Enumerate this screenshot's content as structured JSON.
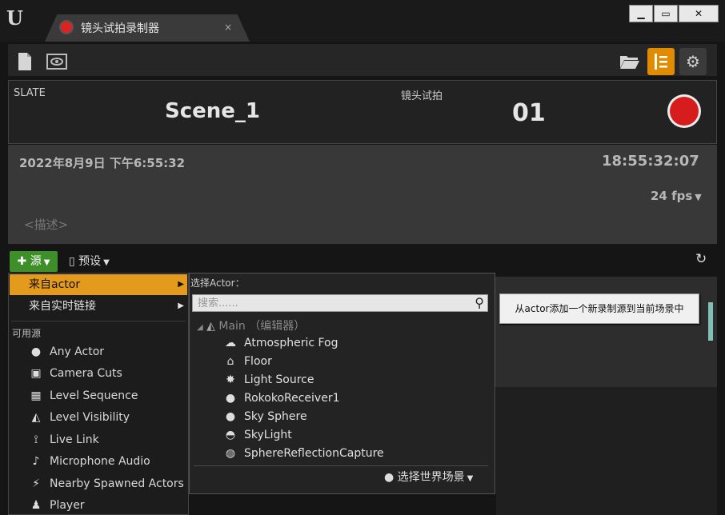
{
  "window": {
    "tab_title": "镜头试拍录制器",
    "tab_close": "×",
    "minimize_glyph": "▁",
    "maximize_glyph": "▭",
    "close_glyph": "✕"
  },
  "toolbar": {
    "new_icon": "document-icon",
    "review_icon": "film-eye-icon",
    "open_icon": "folder-icon",
    "timecode_icon": "timecode-icon",
    "settings_icon": "gears-icon",
    "accent_color": "#e08b00"
  },
  "slate": {
    "slate_label": "SLATE",
    "slate_value": "Scene_1",
    "take_label": "镜头试拍",
    "take_value": "01",
    "record_color": "#d61c1c"
  },
  "info": {
    "datetime": "2022年8月9日 下午6:55:32",
    "timecode": "18:55:32:07",
    "fps": "24 fps",
    "description_placeholder": "<描述>"
  },
  "sources_bar": {
    "add_source_label": "源",
    "presets_label": "预设",
    "add_color": "#3e8e2a"
  },
  "source_menu": {
    "from_actor": "来自actor",
    "from_livelink": "来自实时链接",
    "available_header": "可用源",
    "items": [
      {
        "label": "Any Actor",
        "icon": "sphere-icon"
      },
      {
        "label": "Camera Cuts",
        "icon": "camera-cuts-icon"
      },
      {
        "label": "Level Sequence",
        "icon": "clapper-icon"
      },
      {
        "label": "Level Visibility",
        "icon": "landscape-icon"
      },
      {
        "label": "Live Link",
        "icon": "live-link-icon"
      },
      {
        "label": "Microphone Audio",
        "icon": "microphone-icon"
      },
      {
        "label": "Nearby Spawned Actors",
        "icon": "spawn-icon"
      },
      {
        "label": "Player",
        "icon": "player-icon"
      }
    ]
  },
  "actor_picker": {
    "header": "选择Actor：",
    "search_placeholder": "搜索......",
    "search_value": "",
    "root_label": "Main （编辑器）",
    "actors": [
      {
        "label": "Atmospheric Fog",
        "icon": "fog-icon"
      },
      {
        "label": "Floor",
        "icon": "static-mesh-icon"
      },
      {
        "label": "Light Source",
        "icon": "light-source-icon"
      },
      {
        "label": "RokokoReceiver1",
        "icon": "sphere-icon"
      },
      {
        "label": "Sky Sphere",
        "icon": "sphere-icon"
      },
      {
        "label": "SkyLight",
        "icon": "skylight-icon"
      },
      {
        "label": "SphereReflectionCapture",
        "icon": "reflection-capture-icon"
      }
    ],
    "world_select": "选择世界场景"
  },
  "tooltip": "从actor添加一个新录制源到当前场景中"
}
